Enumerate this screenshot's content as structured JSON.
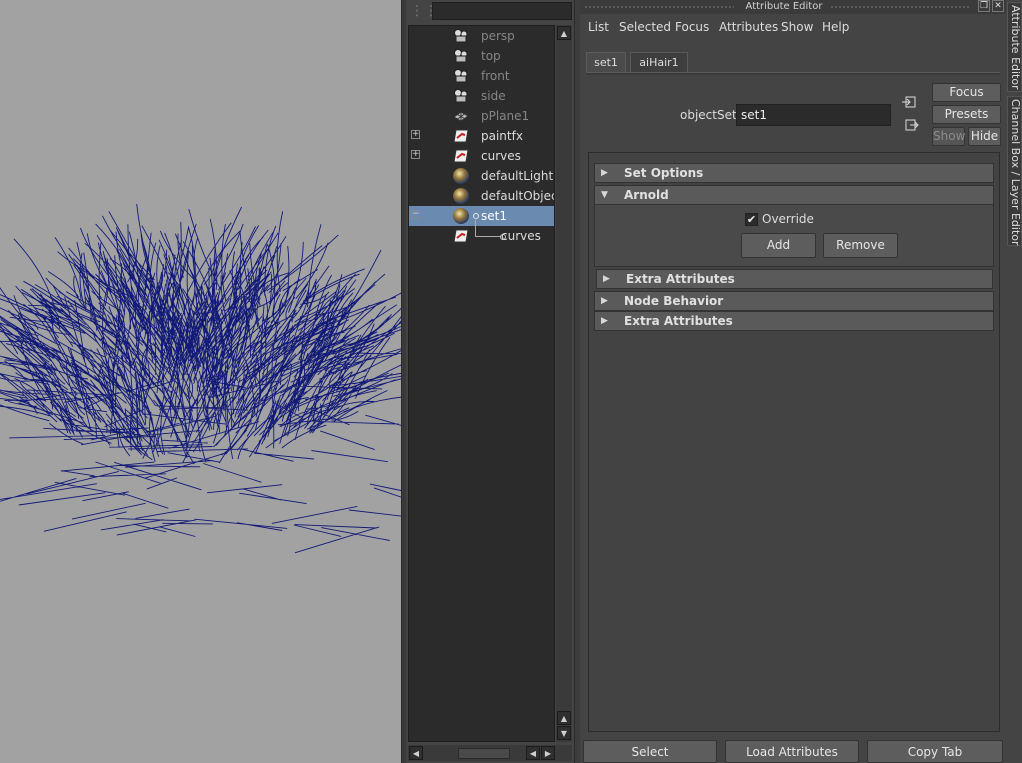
{
  "window": {
    "title": "Attribute Editor"
  },
  "menubar": [
    "List",
    "Selected",
    "Focus",
    "Attributes",
    "Show",
    "Help"
  ],
  "outliner": {
    "items": [
      {
        "label": "persp",
        "icon": "camera-icon",
        "dim": true,
        "expand": ""
      },
      {
        "label": "top",
        "icon": "camera-icon",
        "dim": true,
        "expand": ""
      },
      {
        "label": "front",
        "icon": "camera-icon",
        "dim": true,
        "expand": ""
      },
      {
        "label": "side",
        "icon": "camera-icon",
        "dim": true,
        "expand": ""
      },
      {
        "label": "pPlane1",
        "icon": "plane-icon",
        "dim": true,
        "expand": ""
      },
      {
        "label": "paintfx",
        "icon": "set-icon",
        "dim": false,
        "expand": "+"
      },
      {
        "label": "curves",
        "icon": "set-icon",
        "dim": false,
        "expand": "+"
      },
      {
        "label": "defaultLightSet",
        "icon": "light-set-icon",
        "dim": false,
        "expand": ""
      },
      {
        "label": "defaultObjectSe",
        "icon": "object-set-icon",
        "dim": false,
        "expand": ""
      },
      {
        "label": "set1",
        "icon": "object-set-icon",
        "dim": false,
        "expand": "−",
        "selected": true
      },
      {
        "label": "curves",
        "icon": "set-icon",
        "dim": false,
        "expand": "",
        "child": true
      }
    ]
  },
  "tabs": [
    {
      "label": "set1",
      "active": true
    },
    {
      "label": "aiHair1",
      "active": false
    }
  ],
  "object_set": {
    "label": "objectSet:",
    "value": "set1"
  },
  "side_buttons": {
    "focus": "Focus",
    "presets": "Presets",
    "show": "Show",
    "hide": "Hide"
  },
  "sections": {
    "set_options": "Set Options",
    "arnold": "Arnold",
    "override_label": "Override",
    "override_checked": true,
    "add": "Add",
    "remove": "Remove",
    "extra_attributes_1": "Extra Attributes",
    "node_behavior": "Node Behavior",
    "extra_attributes_2": "Extra Attributes"
  },
  "bottom_buttons": {
    "select": "Select",
    "load_attributes": "Load Attributes",
    "copy_tab": "Copy Tab"
  },
  "dock_tabs": {
    "attribute_editor": "Attribute Editor",
    "channel_box": "Channel Box / Layer Editor"
  },
  "colors": {
    "viewport_bg": "#a2a2a2",
    "hair": "#121a78",
    "selection": "#6a8ab0"
  }
}
